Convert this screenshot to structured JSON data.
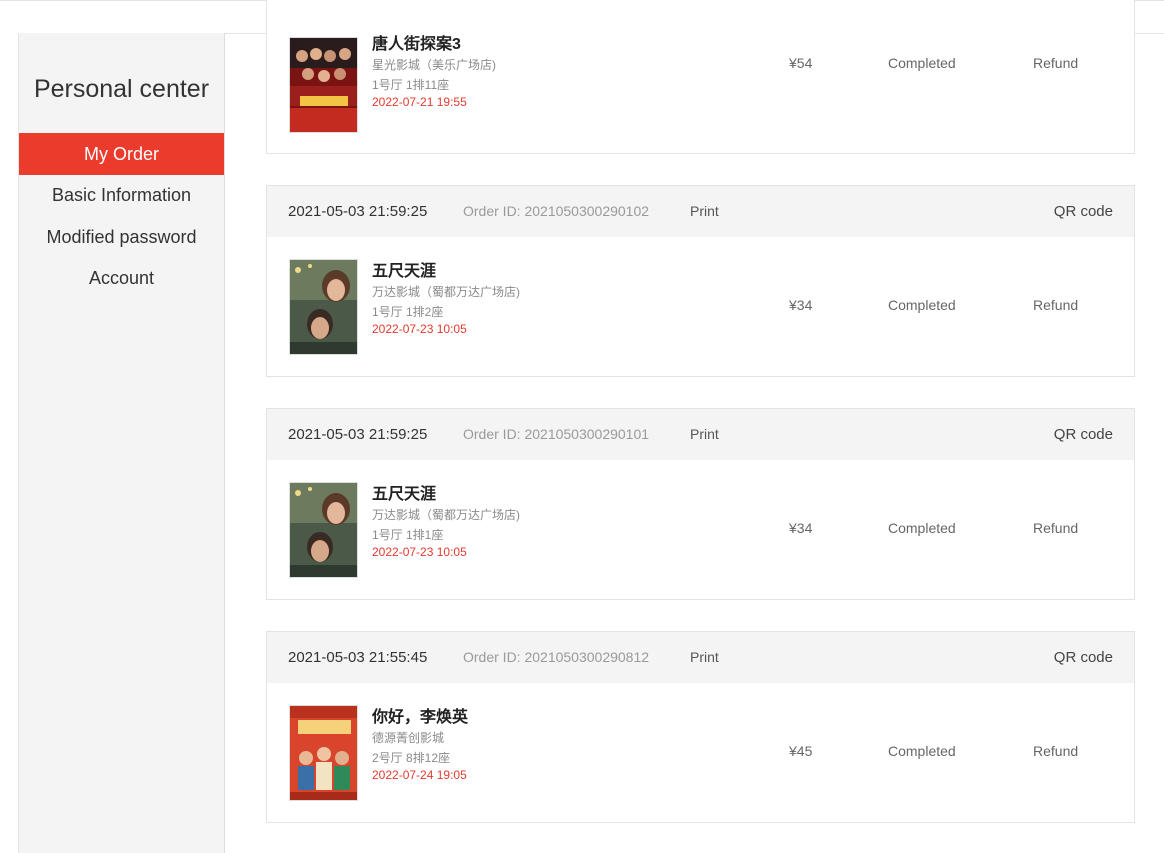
{
  "sidebar": {
    "title": "Personal center",
    "items": [
      {
        "label": "My Order",
        "active": true
      },
      {
        "label": "Basic Information",
        "active": false
      },
      {
        "label": "Modified password",
        "active": false
      },
      {
        "label": "Account",
        "active": false
      }
    ]
  },
  "colors": {
    "accent": "#ea3b2d",
    "showtime_red": "#e33a2e",
    "header_bg": "#f4f4f4"
  },
  "orders": [
    {
      "time": "",
      "order_id": "",
      "print_label": "",
      "qr_label": "",
      "poster_icon": "poster-tangrenjie-icon",
      "title": "唐人街探案3",
      "cinema": "星光影城（美乐广场店)",
      "seat": "1号厅 1排11座",
      "showtime": "2022-07-21 19:55",
      "price": "¥54",
      "status": "Completed",
      "refund": "Refund"
    },
    {
      "time": "2021-05-03 21:59:25",
      "order_id": "Order ID: 2021050300290102",
      "print_label": "Print",
      "qr_label": "QR code",
      "poster_icon": "poster-wuchitianya-icon",
      "title": "五尺天涯",
      "cinema": "万达影城（蜀都万达广场店)",
      "seat": "1号厅 1排2座",
      "showtime": "2022-07-23 10:05",
      "price": "¥34",
      "status": "Completed",
      "refund": "Refund"
    },
    {
      "time": "2021-05-03 21:59:25",
      "order_id": "Order ID: 2021050300290101",
      "print_label": "Print",
      "qr_label": "QR code",
      "poster_icon": "poster-wuchitianya-icon",
      "title": "五尺天涯",
      "cinema": "万达影城（蜀都万达广场店)",
      "seat": "1号厅 1排1座",
      "showtime": "2022-07-23 10:05",
      "price": "¥34",
      "status": "Completed",
      "refund": "Refund"
    },
    {
      "time": "2021-05-03 21:55:45",
      "order_id": "Order ID: 2021050300290812",
      "print_label": "Print",
      "qr_label": "QR code",
      "poster_icon": "poster-nihaolihuanying-icon",
      "title": "你好，李焕英",
      "cinema": "德源菁创影城",
      "seat": "2号厅 8排12座",
      "showtime": "2022-07-24 19:05",
      "price": "¥45",
      "status": "Completed",
      "refund": "Refund"
    }
  ]
}
